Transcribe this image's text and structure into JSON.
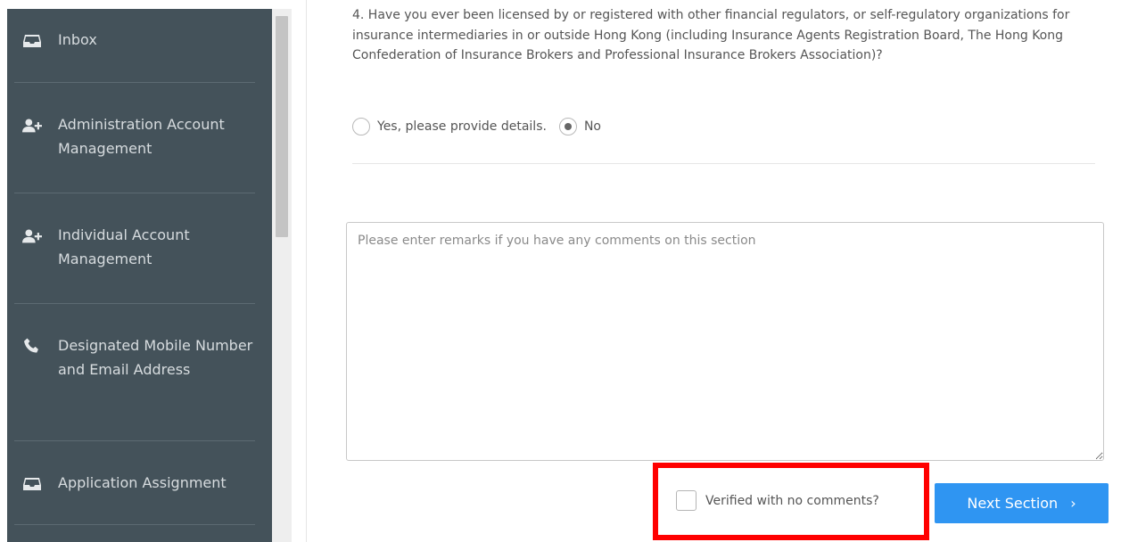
{
  "sidebar": {
    "items": [
      {
        "label": "Inbox",
        "icon": "inbox-icon"
      },
      {
        "label": "Administration Account Management",
        "icon": "add-user-icon"
      },
      {
        "label": "Individual Account Management",
        "icon": "add-user-icon"
      },
      {
        "label": "Designated Mobile Number and Email Address",
        "icon": "phone-icon"
      },
      {
        "label": "Application Assignment",
        "icon": "inbox-icon"
      }
    ]
  },
  "question": {
    "text": "4. Have you ever been licensed by or registered with other financial regulators, or self-regulatory organizations for insurance intermediaries in or outside Hong Kong (including Insurance Agents Registration Board, The Hong Kong Confederation of Insurance Brokers and Professional Insurance Brokers Association)?",
    "options": [
      {
        "label": "Yes, please provide details.",
        "checked": false
      },
      {
        "label": "No",
        "checked": true
      }
    ]
  },
  "remarks": {
    "placeholder": "Please enter remarks if you have any comments on this section",
    "value": ""
  },
  "verify": {
    "label": "Verified with no comments?",
    "checked": false
  },
  "next_button": {
    "label": "Next Section",
    "chevron": "›"
  },
  "colors": {
    "sidebar_bg": "#44525a",
    "accent": "#2f95f2",
    "highlight": "#ff0000"
  }
}
